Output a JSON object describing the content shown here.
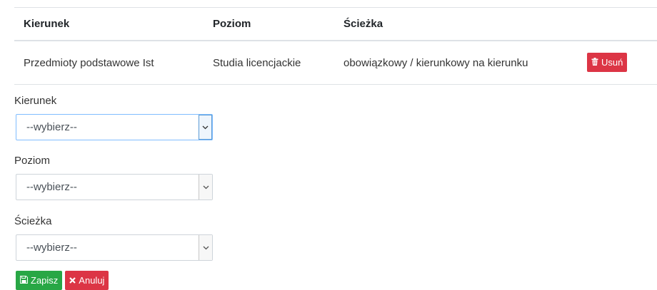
{
  "table": {
    "headers": [
      "Kierunek",
      "Poziom",
      "Ścieżka"
    ],
    "rows": [
      {
        "kierunek": "Przedmioty podstawowe Ist",
        "poziom": "Studia licencjackie",
        "sciezka": "obowiązkowy / kierunkowy na kierunku",
        "delete_label": "Usuń"
      }
    ]
  },
  "form": {
    "kierunek": {
      "label": "Kierunek",
      "value": "--wybierz--"
    },
    "poziom": {
      "label": "Poziom",
      "value": "--wybierz--"
    },
    "sciezka": {
      "label": "Ścieżka",
      "value": "--wybierz--"
    }
  },
  "actions": {
    "save_label": "Zapisz",
    "cancel_label": "Anuluj"
  },
  "colors": {
    "danger": "#dc3545",
    "success": "#28a745"
  },
  "icons": {
    "delete": "trash-icon",
    "save": "floppy-disk-icon",
    "cancel": "x-icon"
  }
}
